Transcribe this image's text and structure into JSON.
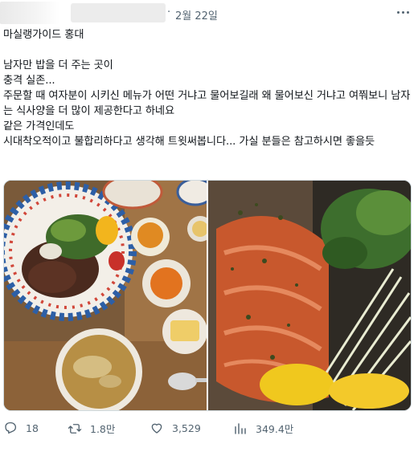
{
  "post": {
    "separator": "·",
    "date": "2월 22일",
    "text": "마실랭가이드 홍대\n\n남자만 밥을 더 주는 곳이\n충격 실존...\n주문할 때 여자분이 시키신 메뉴가 어떤 거냐고 물어보길래 왜 물어보신 거냐고 여쭤보니 남자는 식사양을 더 많이 제공한다고 하네요\n같은 가격인데도\n시대착오적이고 불합리하다고 생각해 트윗써봅니다... 가실 분들은 참고하시면 좋을듯"
  },
  "actions": {
    "replies": "18",
    "retweets": "1.8만",
    "likes": "3,529",
    "views": "349.4만"
  },
  "colors": {
    "text": "#0f1419",
    "muted": "#536471",
    "border": "#cfd9de"
  },
  "icons": [
    "more-icon",
    "reply-icon",
    "retweet-icon",
    "like-icon",
    "views-icon"
  ]
}
